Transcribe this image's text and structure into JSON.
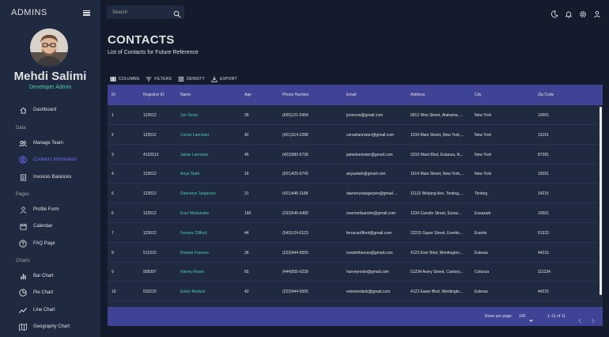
{
  "sidebar": {
    "brand": "ADMINS",
    "user_name": "Mehdi Salimi",
    "user_role": "Developer Admin",
    "sections": {
      "data": "Data",
      "pages": "Pages",
      "charts": "Charts"
    },
    "items": [
      {
        "label": "Dashboard",
        "icon": "home-icon"
      },
      {
        "label": "Manage Team",
        "icon": "team-icon"
      },
      {
        "label": "Contacts Information",
        "icon": "contacts-icon",
        "active": true
      },
      {
        "label": "Invoices Balances",
        "icon": "receipt-icon"
      },
      {
        "label": "Profile Form",
        "icon": "person-icon"
      },
      {
        "label": "Calendar",
        "icon": "calendar-icon"
      },
      {
        "label": "FAQ Page",
        "icon": "help-icon"
      },
      {
        "label": "Bar Chart",
        "icon": "bar-chart-icon"
      },
      {
        "label": "Pie Chart",
        "icon": "pie-chart-icon"
      },
      {
        "label": "Line Chart",
        "icon": "line-chart-icon"
      },
      {
        "label": "Geography Chart",
        "icon": "map-icon"
      }
    ]
  },
  "topbar": {
    "search_placeholder": "Search"
  },
  "header": {
    "title": "CONTACTS",
    "subtitle": "List of Contacts for Future Reference"
  },
  "toolbar": {
    "columns": "COLUMNS",
    "filters": "FILTERS",
    "density": "DENSITY",
    "export": "EXPORT"
  },
  "table": {
    "columns": [
      "ID",
      "Registrar ID",
      "Name",
      "Age",
      "Phone Number",
      "Email",
      "Address",
      "City",
      "Zip Code"
    ],
    "rows": [
      [
        "1",
        "123512",
        "Jon Snow",
        "35",
        "(665)121-5454",
        "jonsnow@gmail.com",
        "0912 Won Street, Alabama, ...",
        "New York",
        "10001"
      ],
      [
        "2",
        "123512",
        "Cersei Lannister",
        "42",
        "(421)314-2288",
        "cerseilannister@gmail.com",
        "1234 Main Street, New York,...",
        "New York",
        "13151"
      ],
      [
        "3",
        "4132513",
        "Jaime Lannister",
        "45",
        "(422)982-6739",
        "jaimelannister@gmail.com",
        "3333 Want Blvd, Estanza, N...",
        "New York",
        "87281"
      ],
      [
        "4",
        "123512",
        "Anya Stark",
        "16",
        "(921)425-6742",
        "anyastark@gmail.com",
        "1514 Main Street, New York,...",
        "New York",
        "15551"
      ],
      [
        "5",
        "123512",
        "Daenerys Targaryen",
        "31",
        "(421)445-1189",
        "daenerystargaryen@gmail....",
        "11122 Welping Ave, Tenting,...",
        "Tenting",
        "14215"
      ],
      [
        "6",
        "123512",
        "Ever Melisandre",
        "150",
        "(232)545-6483",
        "evermelisandre@gmail.com",
        "1234 Canvile Street, Esvaz...",
        "Esvazark",
        "10001"
      ],
      [
        "7",
        "123512",
        "Ferrara Clifford",
        "44",
        "(543)124-0123",
        "ferraraclifford@gmail.com",
        "22215 Super Street, Evertin...",
        "Evertin",
        "51523"
      ],
      [
        "8",
        "512315",
        "Rossini Frances",
        "36",
        "(222)444-5555",
        "rossinifrances@gmail.com",
        "4123 Ever Blvd, Wentington...",
        "Esteras",
        "44215"
      ],
      [
        "9",
        "928397",
        "Harvey Roxie",
        "65",
        "(444)555-6239",
        "harveyroxie@gmail.com",
        "51234 Avery Street, Cantory...",
        "Colunza",
        "111234"
      ],
      [
        "10",
        "533215",
        "Enteri Redack",
        "42",
        "(222)444-5555",
        "enteriredack@gmail.com",
        "4123 Easer Blvd, Wentingto...",
        "Esteras",
        "44215"
      ]
    ]
  },
  "footer": {
    "rows_per_page_label": "Rows per page:",
    "rows_per_page_value": "100",
    "range": "1–11 of 11"
  },
  "colors": {
    "bg": "#141b2d",
    "panel": "#1f2a40",
    "header": "#3e4396",
    "accent_green": "#4cceac",
    "accent_blue": "#6870fa"
  }
}
